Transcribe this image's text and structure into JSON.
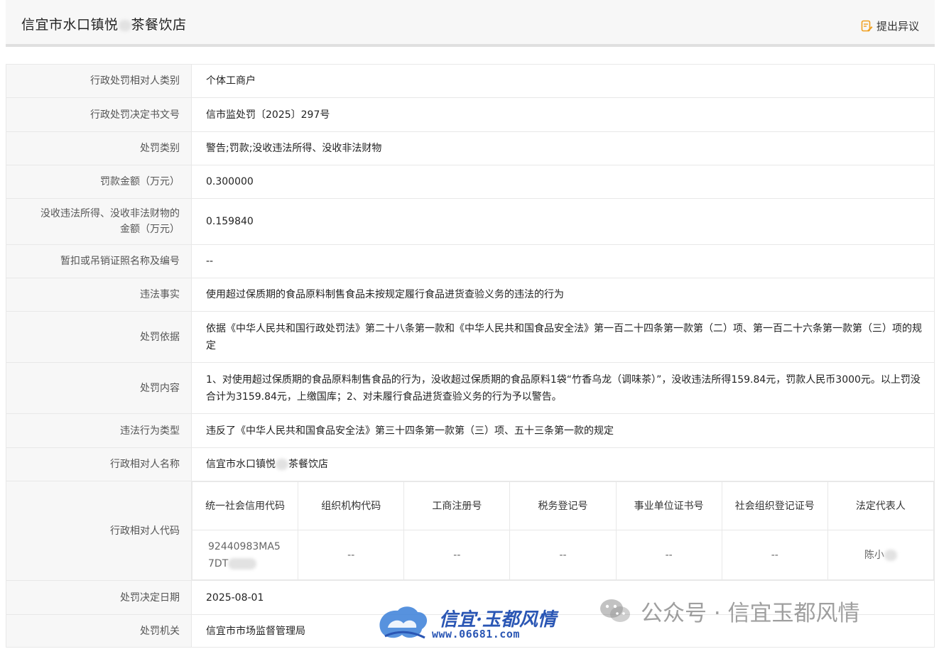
{
  "header": {
    "title": "信宜市水口镇悦",
    "title_suffix": "茶餐饮店",
    "objection_label": "提出异议"
  },
  "rows": {
    "subject_type": {
      "label": "行政处罚相对人类别",
      "value": "个体工商户"
    },
    "decision_no": {
      "label": "行政处罚决定书文号",
      "value": "信市监处罚〔2025〕297号"
    },
    "penalty_type": {
      "label": "处罚类别",
      "value": "警告;罚款;没收违法所得、没收非法财物"
    },
    "fine_amount": {
      "label": "罚款金额（万元）",
      "value": "0.300000"
    },
    "confiscation": {
      "label_line1": "没收违法所得、没收非法财物的",
      "label_line2": "金额（万元）",
      "value": "0.159840"
    },
    "license_suspend": {
      "label": "暂扣或吊销证照名称及编号",
      "value": "--"
    },
    "violation_facts": {
      "label": "违法事实",
      "value": "使用超过保质期的食品原料制售食品未按规定履行食品进货查验义务的违法的行为"
    },
    "basis": {
      "label": "处罚依据",
      "value": "依据《中华人民共和国行政处罚法》第二十八条第一款和《中华人民共和国食品安全法》第一百二十四条第一款第（二）项、第一百二十六条第一款第（三）项的规定"
    },
    "content": {
      "label": "处罚内容",
      "value": "1、对使用超过保质期的食品原料制售食品的行为，没收超过保质期的食品原料1袋“竹香乌龙（调味茶）”，没收违法所得159.84元，罚款人民币3000元。以上罚没合计为3159.84元，上缴国库；2、对未履行食品进货查验义务的行为予以警告。"
    },
    "violation_type": {
      "label": "违法行为类型",
      "value": "违反了《中华人民共和国食品安全法》第三十四条第一款第（三）项、五十三条第一款的规定"
    },
    "subject_name": {
      "label": "行政相对人名称",
      "value_prefix": "信宜市水口镇悦",
      "value_suffix": "茶餐饮店"
    },
    "subject_code": {
      "label": "行政相对人代码",
      "headers": {
        "uscc": "统一社会信用代码",
        "org_code": "组织机构代码",
        "biz_reg": "工商注册号",
        "tax_reg": "税务登记号",
        "inst_cert": "事业单位证书号",
        "soc_org": "社会组织登记证号",
        "legal_rep": "法定代表人"
      },
      "values": {
        "uscc_line1": "92440983MA5",
        "uscc_line2": "7DT",
        "org_code": "--",
        "biz_reg": "--",
        "tax_reg": "--",
        "inst_cert": "--",
        "soc_org": "--",
        "legal_rep": "陈小"
      }
    },
    "decision_date": {
      "label": "处罚决定日期",
      "value": "2025-08-01"
    },
    "authority": {
      "label": "处罚机关",
      "value": "信宜市市场监督管理局"
    }
  },
  "watermark": {
    "brand_cn": "信宜·玉都风情",
    "brand_url": "www.06681.com",
    "wechat_text": "公众号 · 信宜玉都风情"
  },
  "colors": {
    "label_bg": "#f7f7f7",
    "border": "#e8e8e8",
    "accent_orange": "#f0a020",
    "brand_blue": "#2a56b4"
  }
}
